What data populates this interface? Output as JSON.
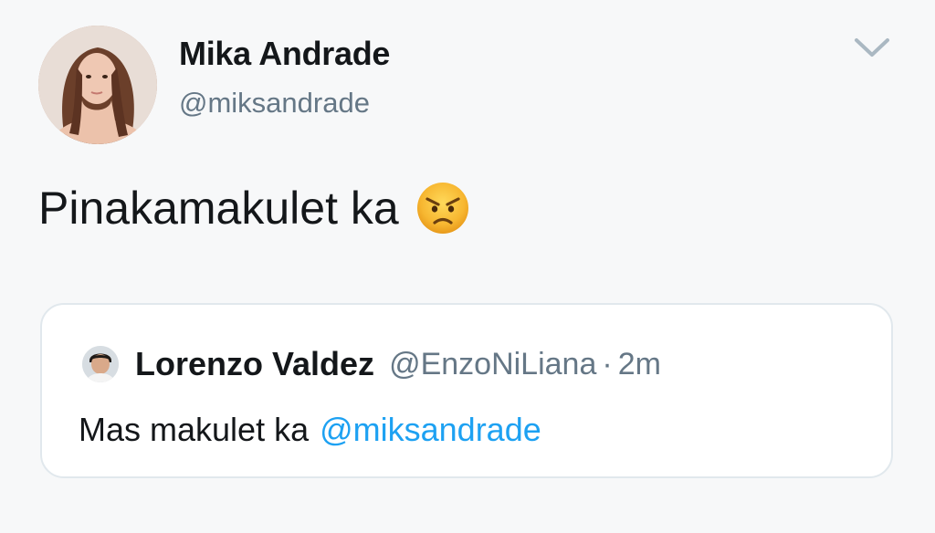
{
  "tweet": {
    "author": {
      "display_name": "Mika Andrade",
      "handle": "@miksandrade"
    },
    "text": "Pinakamakulet ka",
    "emoji": "angry-face-icon"
  },
  "quoted_tweet": {
    "author": {
      "display_name": "Lorenzo Valdez",
      "handle": "@EnzoNiLiana"
    },
    "separator": "·",
    "time": "2m",
    "text": "Mas makulet ka",
    "mention": "@miksandrade"
  },
  "colors": {
    "background": "#f7f8f9",
    "primary_text": "#14171a",
    "secondary_text": "#657786",
    "link": "#1da1f2",
    "card_border": "#e1e8ed"
  }
}
